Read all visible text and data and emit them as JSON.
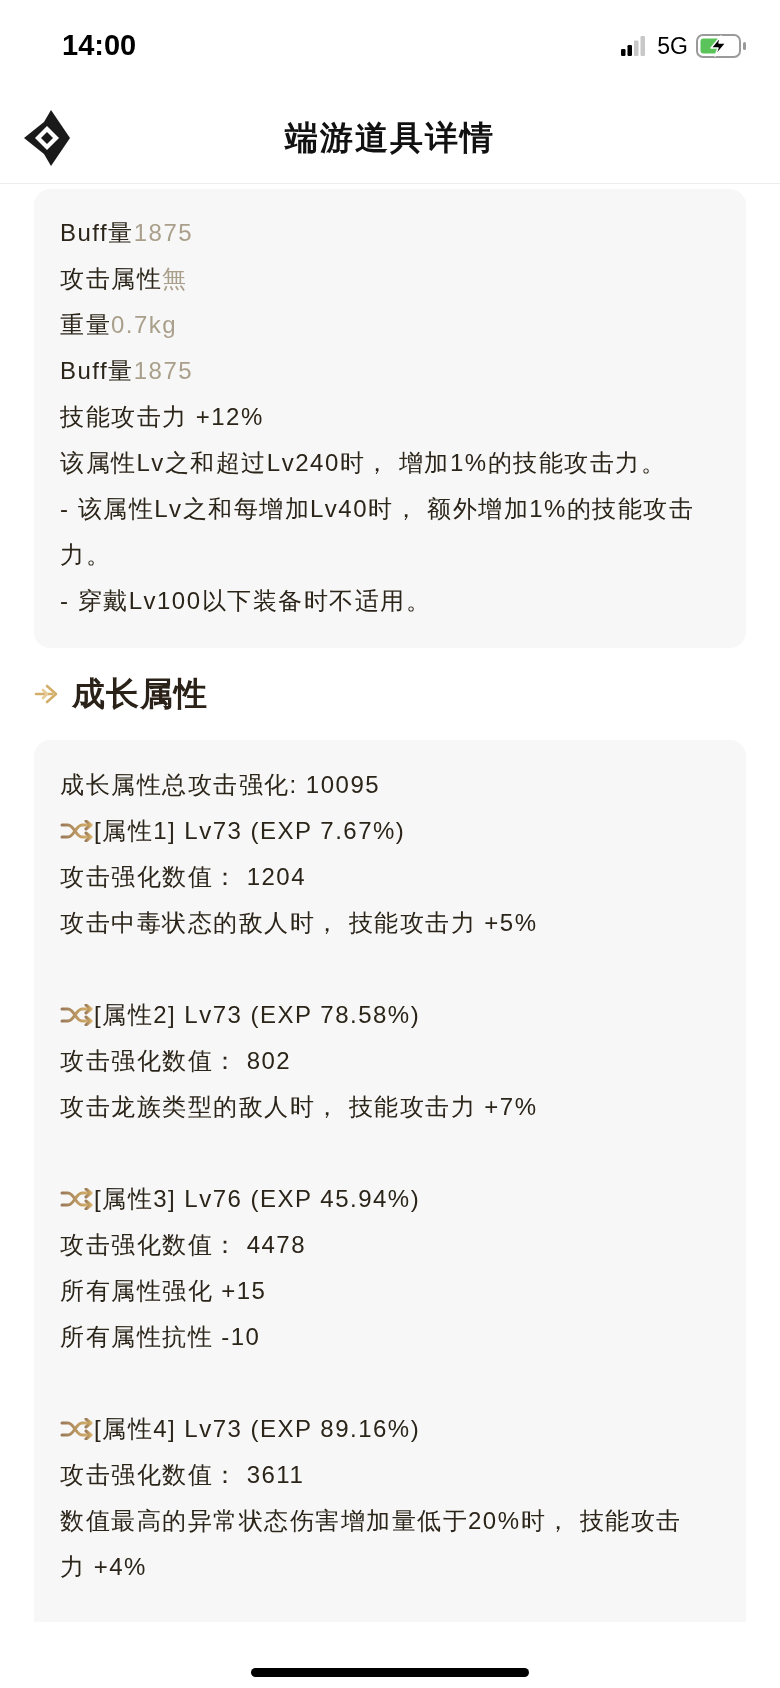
{
  "status_bar": {
    "time": "14:00",
    "network": "5G"
  },
  "header": {
    "title": "端游道具详情"
  },
  "info_card": {
    "lines": [
      {
        "kind": "pair",
        "label": "Buff量",
        "value": "1875"
      },
      {
        "kind": "pair",
        "label": "攻击属性",
        "value": "無"
      },
      {
        "kind": "pair",
        "label": "重量",
        "value": "0.7kg"
      },
      {
        "kind": "pair",
        "label": "Buff量",
        "value": "1875"
      },
      {
        "kind": "text",
        "text": "技能攻击力 +12%"
      },
      {
        "kind": "text",
        "text": "该属性Lv之和超过Lv240时， 增加1%的技能攻击力。"
      },
      {
        "kind": "text",
        "text": "- 该属性Lv之和每增加Lv40时， 额外增加1%的技能攻击力。"
      },
      {
        "kind": "text",
        "text": "- 穿戴Lv100以下装备时不适用。"
      }
    ]
  },
  "growth_section": {
    "title": "成长属性",
    "total": "成长属性总攻击强化: 10095",
    "attributes": [
      {
        "heading": "[属性1] Lv73 (EXP 7.67%)",
        "lines": [
          "攻击强化数值： 1204",
          "攻击中毒状态的敌人时， 技能攻击力 +5%"
        ]
      },
      {
        "heading": "[属性2] Lv73 (EXP 78.58%)",
        "lines": [
          "攻击强化数值： 802",
          "攻击龙族类型的敌人时， 技能攻击力 +7%"
        ]
      },
      {
        "heading": "[属性3] Lv76 (EXP 45.94%)",
        "lines": [
          "攻击强化数值： 4478",
          "所有属性强化 +15",
          "所有属性抗性 -10"
        ]
      },
      {
        "heading": "[属性4] Lv73 (EXP 89.16%)",
        "lines": [
          "攻击强化数值： 3611",
          "数值最高的异常状态伤害增加量低于20%时， 技能攻击力 +4%"
        ]
      }
    ]
  }
}
